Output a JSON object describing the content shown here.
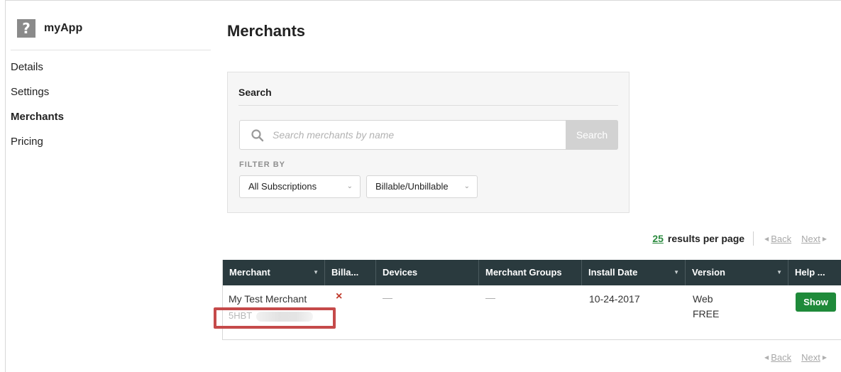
{
  "app": {
    "name": "myApp",
    "icon": "question-mark-app-icon",
    "icon_glyph": "?"
  },
  "sidebar": {
    "items": [
      {
        "label": "Details",
        "active": false
      },
      {
        "label": "Settings",
        "active": false
      },
      {
        "label": "Merchants",
        "active": true
      },
      {
        "label": "Pricing",
        "active": false
      }
    ]
  },
  "page": {
    "title": "Merchants"
  },
  "search": {
    "heading": "Search",
    "placeholder": "Search merchants by name",
    "value": "",
    "button_label": "Search",
    "filter_label": "FILTER BY",
    "filters": [
      {
        "selected": "All Subscriptions"
      },
      {
        "selected": "Billable/Unbillable"
      }
    ]
  },
  "pagination": {
    "per_page": "25",
    "per_page_label": "results per page",
    "back_label": "Back",
    "next_label": "Next"
  },
  "table": {
    "columns": [
      "Merchant",
      "Billa...",
      "Devices",
      "Merchant Groups",
      "Install Date",
      "Version",
      "Help ..."
    ],
    "rows": [
      {
        "merchant_name": "My Test Merchant",
        "merchant_id": "5HBT",
        "billable": "×",
        "devices": "—",
        "merchant_groups": "—",
        "install_date": "10-24-2017",
        "version_line1": "Web",
        "version_line2": "FREE",
        "help_button": "Show"
      }
    ]
  },
  "colors": {
    "header_bg": "#2a3a3e",
    "show_button": "#1f8a3a",
    "per_page_link": "#2a8a3e",
    "highlight_box": "#c54a4a",
    "not_billable_mark": "#c0392b"
  }
}
